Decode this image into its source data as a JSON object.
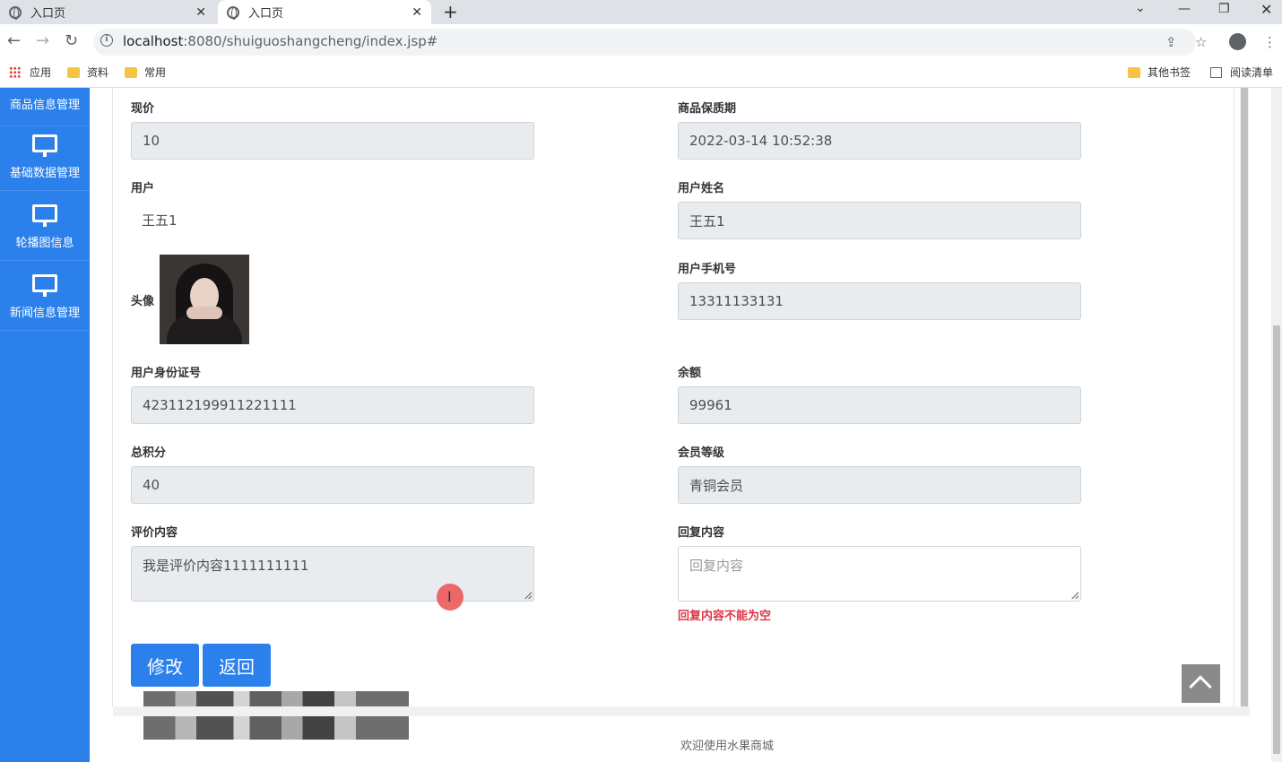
{
  "browser": {
    "tabs": [
      {
        "title": "入口页"
      },
      {
        "title": "入口页"
      }
    ],
    "url_host": "localhost",
    "url_rest": ":8080/shuiguoshangcheng/index.jsp#",
    "bookmarks": {
      "apps": "应用",
      "folder1": "资料",
      "folder2": "常用",
      "other": "其他书签",
      "reading": "阅读清单"
    }
  },
  "sidebar": {
    "items": [
      {
        "label": "商品信息管理"
      },
      {
        "label": "基础数据管理"
      },
      {
        "label": "轮播图信息"
      },
      {
        "label": "新闻信息管理"
      }
    ]
  },
  "form": {
    "price": {
      "label": "现价",
      "value": "10"
    },
    "shelf_life": {
      "label": "商品保质期",
      "value": "2022-03-14 10:52:38"
    },
    "user": {
      "label": "用户",
      "value": "王五1"
    },
    "user_name": {
      "label": "用户姓名",
      "value": "王五1"
    },
    "avatar": {
      "label": "头像"
    },
    "phone": {
      "label": "用户手机号",
      "value": "13311133131"
    },
    "id_card": {
      "label": "用户身份证号",
      "value": "423112199911221111"
    },
    "balance": {
      "label": "余额",
      "value": "99961"
    },
    "points": {
      "label": "总积分",
      "value": "40"
    },
    "level": {
      "label": "会员等级",
      "value": "青铜会员"
    },
    "review": {
      "label": "评价内容",
      "value": "我是评价内容1111111111"
    },
    "reply": {
      "label": "回复内容",
      "placeholder": "回复内容",
      "error": "回复内容不能为空"
    }
  },
  "buttons": {
    "edit": "修改",
    "back": "返回"
  },
  "footer": {
    "text": "欢迎使用水果商城"
  },
  "colors": {
    "primary": "#2b80eb",
    "error": "#dc3545"
  }
}
